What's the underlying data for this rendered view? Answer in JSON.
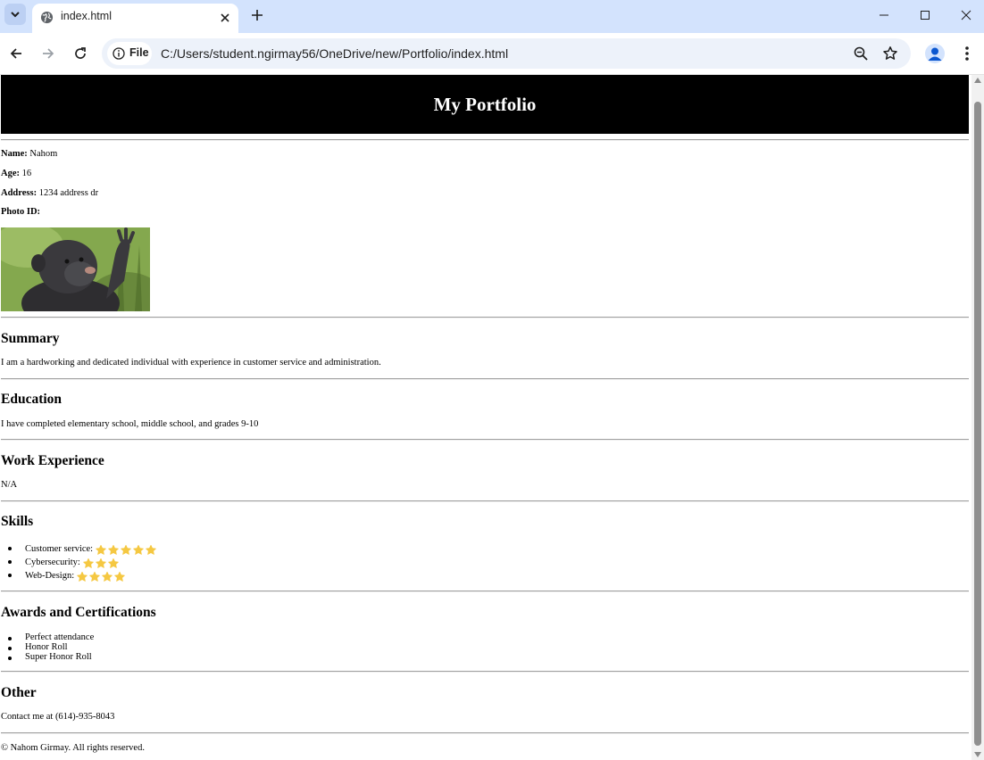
{
  "browser": {
    "tab": {
      "title": "index.html"
    },
    "omnibox": {
      "chip_label": "File",
      "url": "C:/Users/student.ngirmay56/OneDrive/new/Portfolio/index.html"
    }
  },
  "page": {
    "header": {
      "title": "My Portfolio"
    },
    "info": [
      {
        "label": "Name:",
        "value": "Nahom"
      },
      {
        "label": "Age:",
        "value": "16"
      },
      {
        "label": "Address:",
        "value": "1234 address dr"
      },
      {
        "label": "Photo ID:",
        "value": ""
      }
    ],
    "summary": {
      "title": "Summary",
      "text": "I am a hardworking and dedicated individual with experience in customer service and administration."
    },
    "education": {
      "title": "Education",
      "text": "I have completed elementary school, middle school, and grades 9-10"
    },
    "work": {
      "title": "Work Experience",
      "text": "N/A"
    },
    "skills": {
      "title": "Skills",
      "items": [
        {
          "label": "Customer service:",
          "stars": 5
        },
        {
          "label": "Cybersecurity:",
          "stars": 3
        },
        {
          "label": "Web-Design:",
          "stars": 4
        }
      ]
    },
    "awards": {
      "title": "Awards and Certifications",
      "items": [
        "Perfect attendance",
        "Honor Roll",
        "Super Honor Roll"
      ]
    },
    "other": {
      "title": "Other",
      "text": "Contact me at (614)-935-8043"
    },
    "footer": "© Nahom Girmay. All rights reserved."
  },
  "colors": {
    "star": "#f5c842",
    "header_bg": "#000000",
    "tabbar": "#d3e3fd"
  }
}
